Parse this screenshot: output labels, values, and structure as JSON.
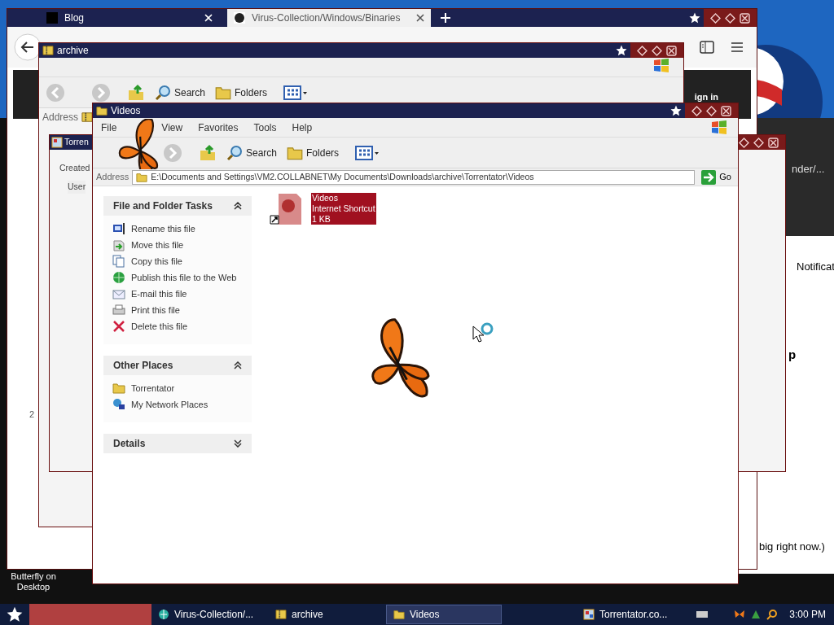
{
  "browser": {
    "tabs": [
      {
        "title": "Blog",
        "selected": false
      },
      {
        "title": "Virus-Collection/Windows/Binaries",
        "selected": true
      }
    ],
    "sign_in": "ign in"
  },
  "back_page": {
    "link": "nder/...",
    "notifications": "Notificat",
    "heading": "p",
    "sentence": "big right now.)",
    "list_number": "2"
  },
  "archive_window": {
    "title": "archive",
    "search": "Search",
    "folders": "Folders",
    "address_label": "Address"
  },
  "torrentator_window": {
    "title": "Torren",
    "created_label": "Created",
    "user_label": "User"
  },
  "videos_window": {
    "title": "Videos",
    "menu": [
      "File",
      "View",
      "Favorites",
      "Tools",
      "Help"
    ],
    "search": "Search",
    "folders": "Folders",
    "address_label": "Address",
    "address": "E:\\Documents and Settings\\VM2.COLLABNET\\My Documents\\Downloads\\archive\\Torrentator\\Videos",
    "go": "Go",
    "panels": [
      {
        "title": "File and Folder Tasks",
        "expanded": true,
        "items": [
          "Rename this file",
          "Move this file",
          "Copy this file",
          "Publish this file to the Web",
          "E-mail this file",
          "Print this file",
          "Delete this file"
        ]
      },
      {
        "title": "Other Places",
        "expanded": true,
        "items": [
          "Torrentator",
          "My Network Places"
        ]
      },
      {
        "title": "Details",
        "expanded": false
      }
    ],
    "files": [
      {
        "name": "Videos",
        "type": "Internet Shortcut",
        "size": "1 KB",
        "selected": true
      }
    ]
  },
  "desktop_icon": {
    "label": "Butterfly on Desktop"
  },
  "taskbar": {
    "tasks": [
      {
        "label": "Virus-Collection/...",
        "selected": false
      },
      {
        "label": "archive",
        "selected": false
      },
      {
        "label": "Videos",
        "selected": true
      },
      {
        "label": "Torrentator.co...",
        "selected": false
      }
    ],
    "clock": "3:00 PM"
  }
}
